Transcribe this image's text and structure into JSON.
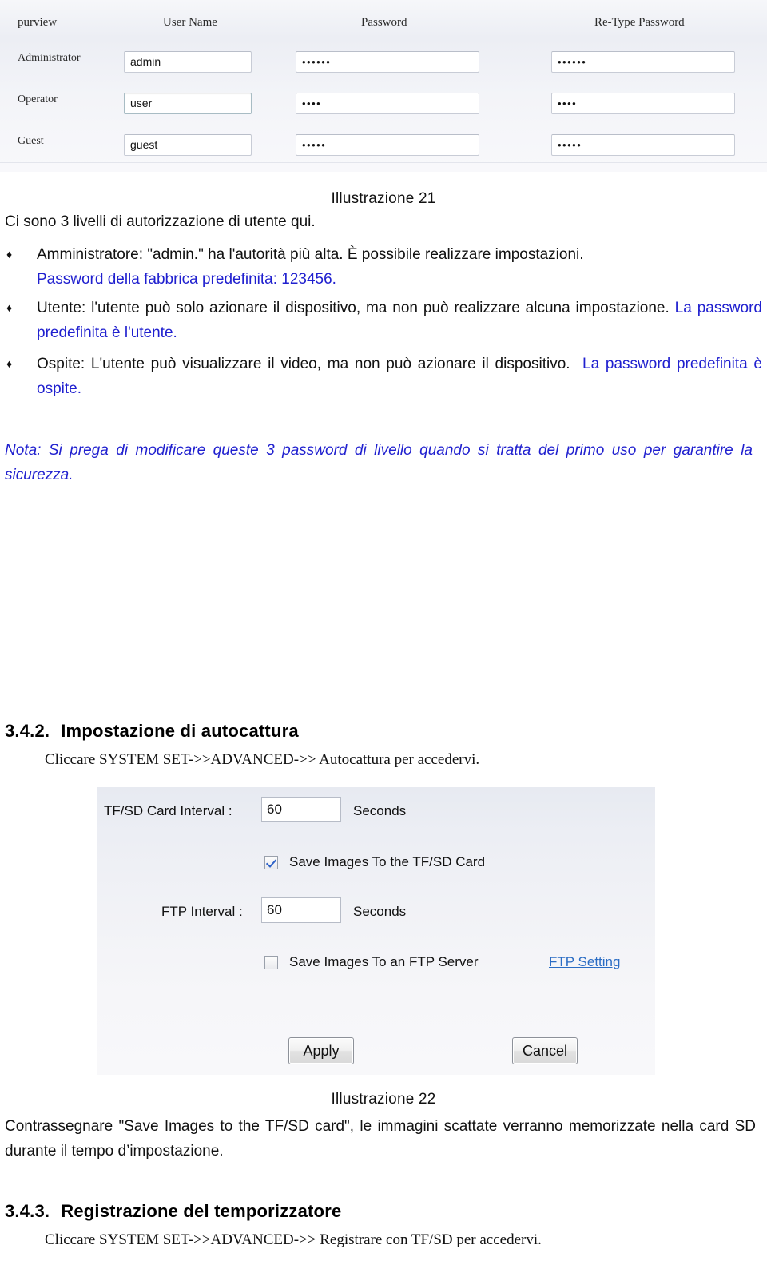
{
  "users_panel": {
    "headers": [
      "purview",
      "User Name",
      "Password",
      "Re-Type Password"
    ],
    "rows": [
      {
        "purview": "Administrator",
        "username": "admin",
        "password": "••••••",
        "retype": "••••••"
      },
      {
        "purview": "Operator",
        "username": "user",
        "password": "••••",
        "retype": "••••"
      },
      {
        "purview": "Guest",
        "username": "guest",
        "password": "•••••",
        "retype": "•••••"
      }
    ]
  },
  "figure_21_caption": "Illustrazione 21",
  "intro_line": "Ci sono 3 livelli di autorizzazione di utente qui.",
  "bullets": [
    {
      "mark": "♦",
      "black1": "Amministratore: \"admin.\" ha l'autorità più alta. È possibile realizzare impostazioni.",
      "blue1": "Password della fabbrica predefinita: 123456."
    },
    {
      "mark": "♦",
      "black1": "Utente: l'utente può solo azionare il dispositivo, ma non può realizzare alcuna impostazione.",
      "blue1": "La password predefinita è l'utente."
    },
    {
      "mark": "♦",
      "black1": "Ospite: L'utente può visualizzare il video, ma non può azionare il dispositivo.",
      "blue1": "La password predefinita è ospite."
    }
  ],
  "note_text": "Nota: Si prega di modificare queste 3 password di livello quando si tratta del primo uso per garantire la sicurezza.",
  "section_342": {
    "number": "3.4.2.",
    "title": "Impostazione di autocattura",
    "subtitle": "Cliccare SYSTEM SET->>ADVANCED->> Autocattura per accedervi."
  },
  "capture_panel": {
    "tfsd_interval_label": "TF/SD Card Interval :",
    "tfsd_interval_value": "60",
    "tfsd_interval_unit": "Seconds",
    "save_tfsd_label": "Save Images To the TF/SD Card",
    "save_tfsd_checked": "true",
    "ftp_interval_label": "FTP Interval :",
    "ftp_interval_value": "60",
    "ftp_interval_unit": "Seconds",
    "save_ftp_label": "Save Images To an FTP Server",
    "save_ftp_checked": "false",
    "ftp_setting_link": "FTP Setting",
    "apply_button": "Apply",
    "cancel_button": "Cancel"
  },
  "figure_22_caption": "Illustrazione 22",
  "after_fig22_text": "Contrassegnare \"Save Images to the TF/SD card\", le immagini scattate verranno memorizzate nella card SD durante il tempo d’impostazione.",
  "section_343": {
    "number": "3.4.3.",
    "title": "Registrazione del temporizzatore",
    "subtitle": "Cliccare SYSTEM SET->>ADVANCED->> Registrare con TF/SD per accedervi."
  },
  "colors": {
    "link_blue": "#2a6cc4",
    "text_blue": "#2020cf",
    "panel_bg": "#eceef4",
    "checkmark_blue": "#2e62c8"
  }
}
